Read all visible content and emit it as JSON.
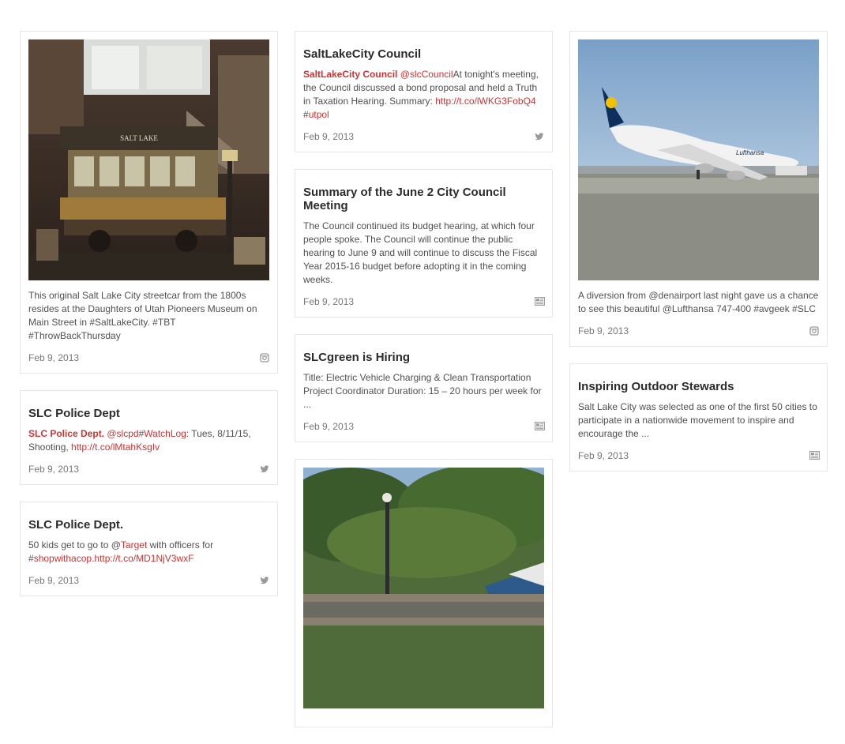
{
  "col1": {
    "photo_card": {
      "caption": "This original Salt Lake City streetcar from the 1800s resides at the Daughters of Utah Pioneers Museum on Main Street in #SaltLakeCity. #TBT #ThrowBackThursday",
      "date": "Feb 9, 2013",
      "source_icon": "instagram-icon",
      "photo_sign": "SALT LAKE"
    },
    "tweet1": {
      "title": "SLC Police Dept",
      "author": "SLC Police Dept.",
      "handle": "@slcpd",
      "hash": "#",
      "tag": "WatchLog",
      "text": ": Tues, 8/11/15, Shooting, ",
      "url": "http://t.co/lMtahKsgIv",
      "date": "Feb 9, 2013",
      "source_icon": "twitter-icon"
    },
    "tweet2": {
      "title": "SLC Police Dept.",
      "text_before": "50 kids get to go to @",
      "tag": "Target",
      "text_mid": " with officers for #",
      "tag2": "shopwithacop",
      "url": ".http://t.co/MD1NjV3wxF",
      "date": "Feb 9, 2013",
      "source_icon": "twitter-icon"
    }
  },
  "col2": {
    "tweet": {
      "title": "SaltLakeCity Council",
      "author": "SaltLakeCity Council",
      "handle": "@slcCouncil",
      "text": "At tonight's meeting, the Council discussed a bond proposal and held a Truth in Taxation Hearing. Summary: ",
      "url": "http://t.co/lWKG3FobQ4",
      "hash": " #",
      "tag": "utpol",
      "date": "Feb 9, 2013",
      "source_icon": "twitter-icon"
    },
    "news1": {
      "title": "Summary of the June 2 City Council Meeting",
      "text": "The Council continued its budget hearing, at which four people spoke. The Council will continue the public hearing to June 9 and will continue to discuss the Fiscal Year 2015-16 budget before adopting it in the coming weeks.",
      "date": "Feb 9, 2013",
      "source_icon": "news-icon"
    },
    "news2": {
      "title": "SLCgreen is Hiring",
      "text": "Title: Electric Vehicle Charging & Clean Transportation Project Coordinator Duration: 15 – 20 hours per week for ...",
      "date": "Feb 9, 2013",
      "source_icon": "news-icon"
    }
  },
  "col3": {
    "photo_card": {
      "caption": "A diversion from @denairport last night gave us a chance to see this beautiful @Lufthansa 747-400 #avgeek #SLC",
      "date": "Feb 9, 2013",
      "source_icon": "instagram-icon",
      "plane_livery": "Lufthansa"
    },
    "news": {
      "title": "Inspiring Outdoor Stewards",
      "text": "Salt Lake City was selected as one of the first 50 cities to participate in a nationwide movement to inspire and encourage the ...",
      "date": "Feb 9, 2013",
      "source_icon": "news-icon"
    }
  },
  "colors": {
    "link": "#cc3333",
    "title": "#2b2b2b",
    "border": "#e6e6e6"
  }
}
